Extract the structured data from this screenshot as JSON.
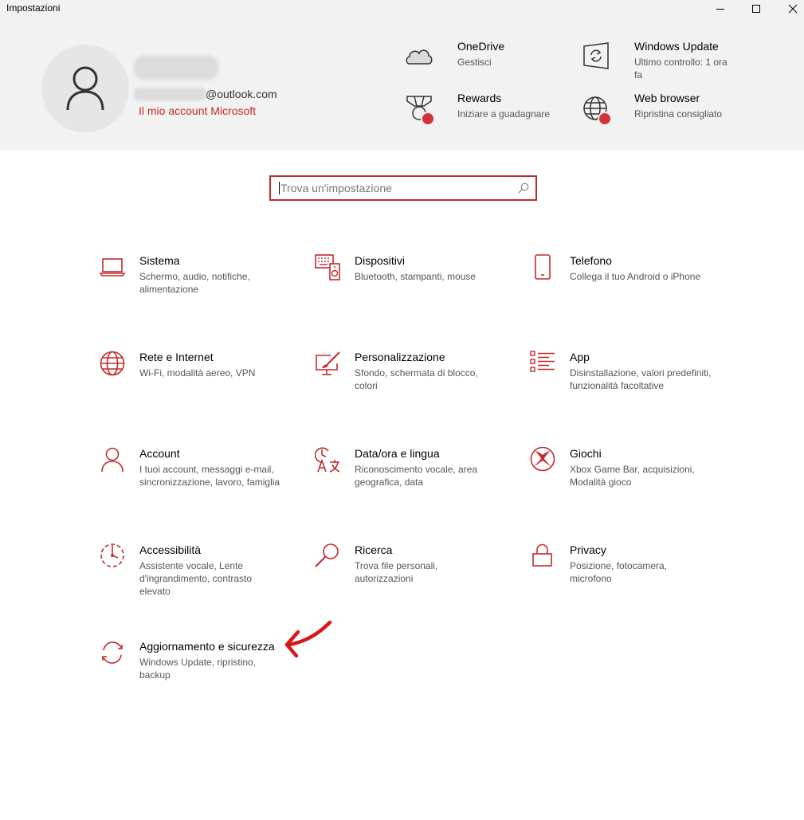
{
  "window": {
    "title": "Impostazioni"
  },
  "account": {
    "email_suffix": "@outlook.com",
    "link": "Il mio account Microsoft"
  },
  "quick_links": [
    {
      "title": "OneDrive",
      "sub": "Gestisci",
      "icon": "cloud-icon"
    },
    {
      "title": "Windows Update",
      "sub": "Ultimo controllo: 1 ora fa",
      "icon": "windows-update-icon"
    },
    {
      "title": "Rewards",
      "sub": "Iniziare a guadagnare",
      "icon": "rewards-medal-icon"
    },
    {
      "title": "Web browser",
      "sub": "Ripristina consigliato",
      "icon": "globe-icon"
    }
  ],
  "search": {
    "placeholder": "Trova un'impostazione"
  },
  "categories": [
    {
      "title": "Sistema",
      "sub": "Schermo, audio, notifiche, alimentazione",
      "icon": "laptop-icon"
    },
    {
      "title": "Dispositivi",
      "sub": "Bluetooth, stampanti, mouse",
      "icon": "keyboard-speaker-icon"
    },
    {
      "title": "Telefono",
      "sub": "Collega il tuo Android o iPhone",
      "icon": "phone-icon"
    },
    {
      "title": "Rete e Internet",
      "sub": "Wi-Fi, modalità aereo, VPN",
      "icon": "globe-icon"
    },
    {
      "title": "Personalizzazione",
      "sub": "Sfondo, schermata di blocco, colori",
      "icon": "paint-brush-icon"
    },
    {
      "title": "App",
      "sub": "Disinstallazione, valori predefiniti, funzionalità facoltative",
      "icon": "app-list-icon"
    },
    {
      "title": "Account",
      "sub": "I tuoi account, messaggi e-mail, sincronizzazione, lavoro, famiglia",
      "icon": "person-icon"
    },
    {
      "title": "Data/ora e lingua",
      "sub": "Riconoscimento vocale, area geografica, data",
      "icon": "time-language-icon"
    },
    {
      "title": "Giochi",
      "sub": "Xbox Game Bar, acquisizioni, Modalità gioco",
      "icon": "xbox-icon"
    },
    {
      "title": "Accessibilità",
      "sub": "Assistente vocale, Lente d'ingrandimento, contrasto elevato",
      "icon": "ease-of-access-icon"
    },
    {
      "title": "Ricerca",
      "sub": "Trova file personali, autorizzazioni",
      "icon": "search-icon"
    },
    {
      "title": "Privacy",
      "sub": "Posizione, fotocamera, microfono",
      "icon": "lock-icon"
    },
    {
      "title": "Aggiornamento e sicurezza",
      "sub": "Windows Update, ripristino, backup",
      "icon": "sync-arrows-icon"
    }
  ],
  "colors": {
    "accent": "#c42b2b",
    "header_bg": "#f2f2f2",
    "badge": "#d13438"
  }
}
